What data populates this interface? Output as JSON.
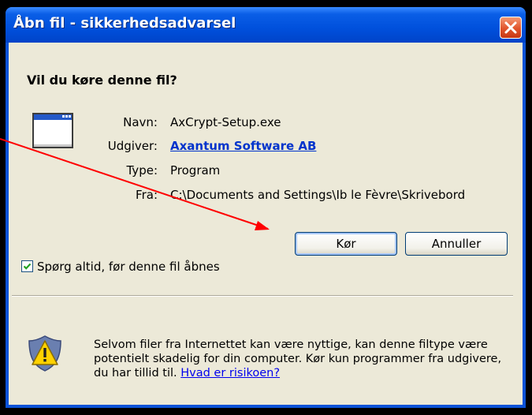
{
  "dialog": {
    "title": "Åbn fil - sikkerhedsadvarsel",
    "question": "Vil du køre denne fil?",
    "fields": {
      "name_label": "Navn:",
      "name_value": "AxCrypt-Setup.exe",
      "publisher_label": "Udgiver:",
      "publisher_value": "Axantum Software AB",
      "type_label": "Type:",
      "type_value": "Program",
      "from_label": "Fra:",
      "from_value": "C:\\Documents and Settings\\Ib le Fèvre\\Skrivebord"
    },
    "buttons": {
      "run": "Kør",
      "cancel": "Annuller"
    },
    "checkbox": {
      "label": "Spørg altid, før denne fil åbnes",
      "checked": true
    },
    "warning": {
      "text": "Selvom filer fra Internettet kan være nyttige, kan denne filtype være potentielt skadelig for din computer. Kør kun programmer fra udgivere, du har tillid til.",
      "link": "Hvad er risikoen?"
    }
  },
  "colors": {
    "titlebar": "#0050dc",
    "client": "#ece9d8",
    "close": "#e1542c",
    "annotation_arrow": "#ff0000"
  },
  "icons": {
    "app": "window-app-icon",
    "warning": "shield-warning-icon",
    "close": "close-icon",
    "check": "checkmark-icon"
  }
}
